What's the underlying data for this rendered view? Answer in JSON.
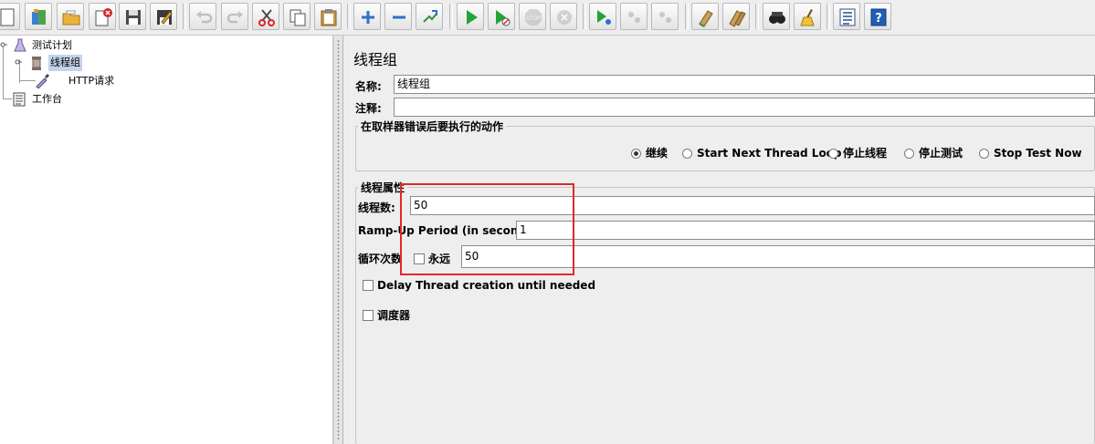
{
  "tree": {
    "items": [
      {
        "label": "测试计划"
      },
      {
        "label": "线程组"
      },
      {
        "label": "HTTP请求"
      },
      {
        "label": "工作台"
      }
    ]
  },
  "panel": {
    "title": "线程组",
    "name_label": "名称:",
    "name_value": "线程组",
    "comment_label": "注释:",
    "comment_value": "",
    "error_action": {
      "title": "在取样器错误后要执行的动作",
      "options": [
        "继续",
        "Start Next Thread Loop",
        "停止线程",
        "停止测试",
        "Stop Test Now"
      ],
      "selected": "继续"
    },
    "thread_props": {
      "title": "线程属性",
      "threads_label": "线程数:",
      "threads_value": "50",
      "rampup_label": "Ramp-Up Period (in seconds):",
      "rampup_value": "1",
      "loop_label": "循环次数",
      "forever_label": "永远",
      "forever_checked": false,
      "loop_value": "50",
      "delay_label": "Delay Thread creation until needed",
      "delay_checked": false,
      "scheduler_label": "调度器",
      "scheduler_checked": false
    }
  },
  "colors": {
    "highlight_box": "#e0292b",
    "tree_selection": "#c3d3ea"
  }
}
